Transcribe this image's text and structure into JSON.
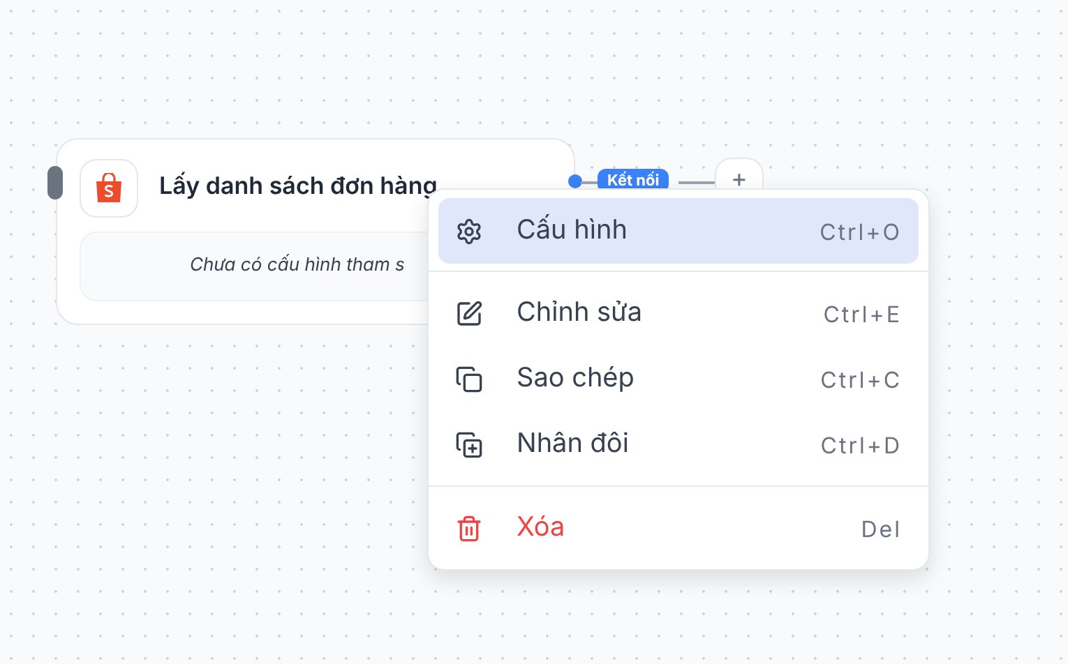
{
  "node": {
    "title": "Lấy danh sách đơn hàng",
    "placeholder_text": "Chưa có cấu hình tham s"
  },
  "connector": {
    "label": "Kết nối",
    "add_button": "+"
  },
  "context_menu": {
    "groups": [
      [
        {
          "label": "Cấu hình",
          "shortcut": "Ctrl+O",
          "kind": "configure",
          "selected": true
        }
      ],
      [
        {
          "label": "Chỉnh sửa",
          "shortcut": "Ctrl+E",
          "kind": "edit",
          "selected": false
        },
        {
          "label": "Sao chép",
          "shortcut": "Ctrl+C",
          "kind": "copy",
          "selected": false
        },
        {
          "label": "Nhân đôi",
          "shortcut": "Ctrl+D",
          "kind": "duplicate",
          "selected": false
        }
      ],
      [
        {
          "label": "Xóa",
          "shortcut": "Del",
          "kind": "delete",
          "selected": false
        }
      ]
    ]
  }
}
